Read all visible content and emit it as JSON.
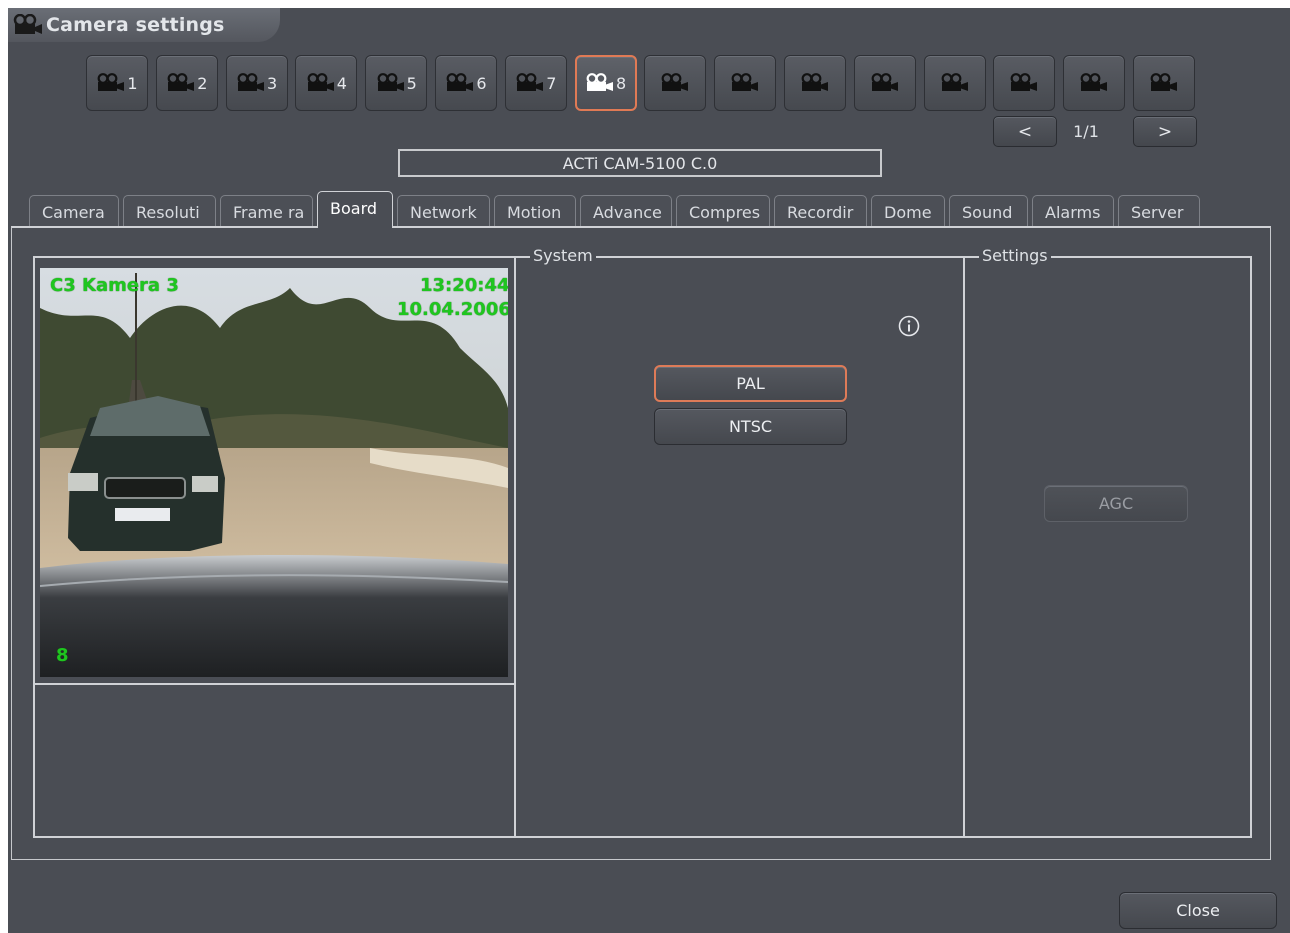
{
  "window": {
    "title": "Camera settings"
  },
  "camera_buttons": [
    "1",
    "2",
    "3",
    "4",
    "5",
    "6",
    "7",
    "8",
    "",
    "",
    "",
    "",
    "",
    "",
    "",
    ""
  ],
  "active_camera_index": 7,
  "pager": {
    "prev": "<",
    "next": ">",
    "page": "1/1"
  },
  "camera_model": "ACTi CAM-5100 C.0",
  "tabs": [
    "Camera",
    "Resoluti",
    "Frame ra",
    "Board",
    "Network",
    "Motion",
    "Advance",
    "Compres",
    "Recordir",
    "Dome",
    "Sound",
    "Alarms",
    "Server"
  ],
  "active_tab_index": 3,
  "preview": {
    "label": "C3 Kamera 3",
    "time": "13:20:44",
    "date": "10.04.2006",
    "channel": "8"
  },
  "system": {
    "title": "System",
    "pal": "PAL",
    "ntsc": "NTSC"
  },
  "settings": {
    "title": "Settings",
    "agc": "AGC"
  },
  "footer": {
    "close": "Close"
  }
}
